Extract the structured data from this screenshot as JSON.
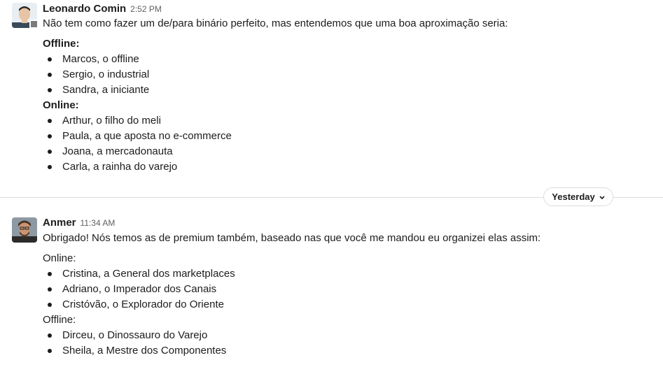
{
  "messages": [
    {
      "sender": "Leonardo Comin",
      "time": "2:52 PM",
      "intro": "Não tem como fazer um de/para binário perfeito, mas entendemos que uma boa aproximação seria:",
      "group1_title": "Offline:",
      "group1_items": [
        "Marcos, o offline",
        "Sergio, o industrial",
        "Sandra, a iniciante"
      ],
      "group2_title": "Online:",
      "group2_items": [
        "Arthur, o filho do meli",
        "Paula, a que aposta no e-commerce",
        "Joana, a mercadonauta",
        "Carla, a rainha do varejo"
      ]
    },
    {
      "sender": "Anmer",
      "time": "11:34 AM",
      "intro": "Obrigado! Nós temos as de premium também, baseado nas que você me mandou eu organizei elas assim:",
      "group1_title": "Online:",
      "group1_items": [
        "Cristina, a General dos marketplaces",
        "Adriano, o Imperador dos Canais",
        "Cristóvão, o Explorador do Oriente"
      ],
      "group2_title": "Offline:",
      "group2_items": [
        "Dirceu, o Dinossauro do Varejo",
        "Sheila, a Mestre dos Componentes"
      ]
    }
  ],
  "date_divider": {
    "label": "Yesterday",
    "icon": "chevron-down-icon"
  },
  "colors": {
    "text": "#1d1c1d",
    "muted": "#616061",
    "divider": "#dddddd",
    "presence_away": "#7b7b7b"
  }
}
